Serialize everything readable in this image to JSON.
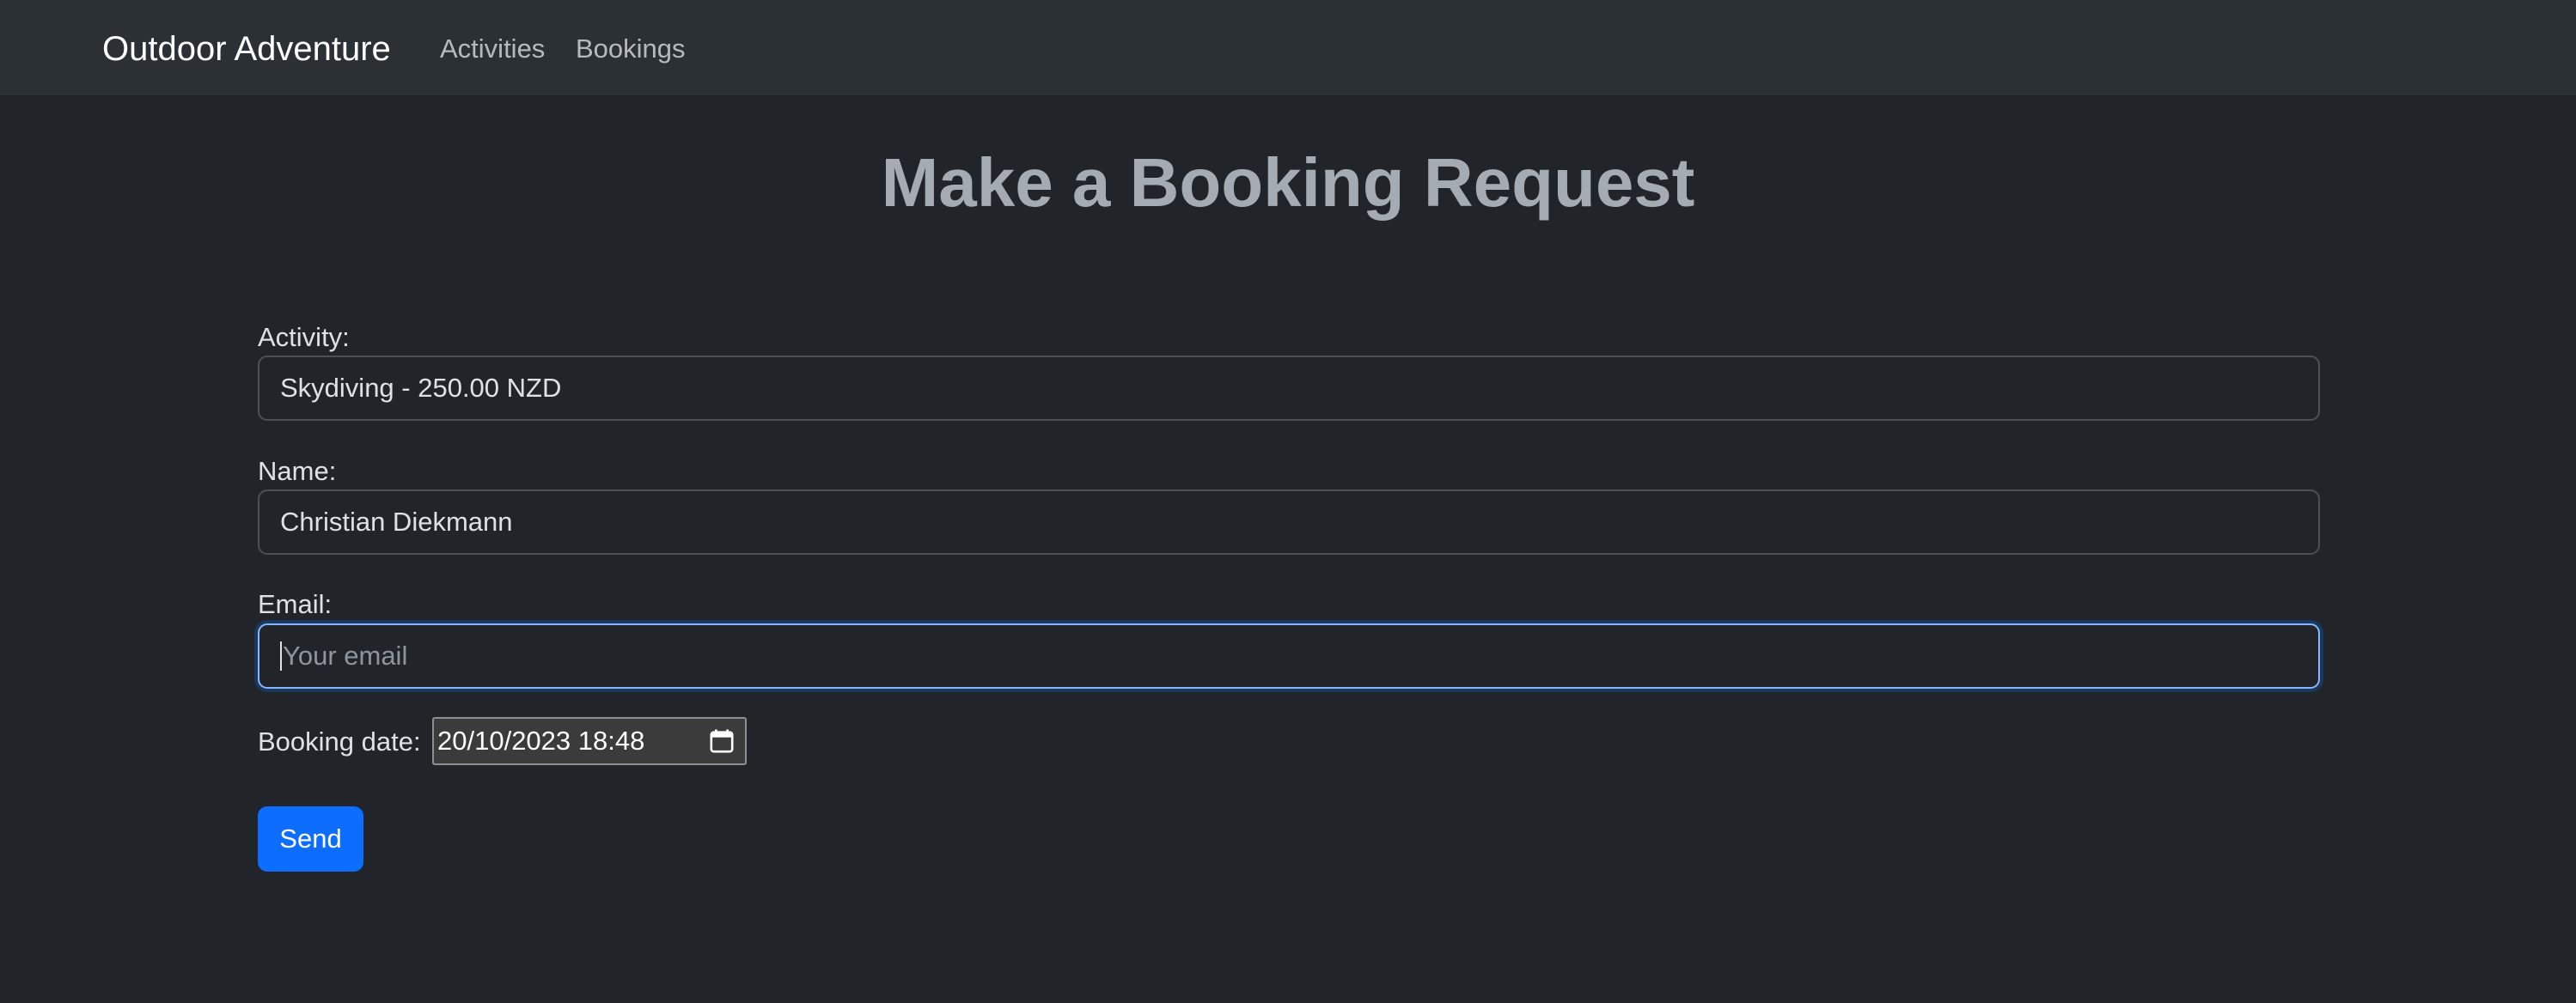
{
  "navbar": {
    "brand": "Outdoor Adventure",
    "links": [
      {
        "label": "Activities"
      },
      {
        "label": "Bookings"
      }
    ]
  },
  "page": {
    "title": "Make a Booking Request"
  },
  "form": {
    "activity": {
      "label": "Activity:",
      "value": "Skydiving - 250.00 NZD"
    },
    "name": {
      "label": "Name:",
      "value": "Christian Diekmann"
    },
    "email": {
      "label": "Email:",
      "value": "",
      "placeholder": "Your email",
      "focused": true
    },
    "booking_date": {
      "label": "Booking date:",
      "value": "20/10/2023 18:48",
      "icon": "calendar-icon"
    },
    "submit_label": "Send"
  },
  "colors": {
    "background": "#212529",
    "navbar": "#2b3035",
    "primary": "#0d6efd",
    "focus_border": "#86b7fe"
  }
}
